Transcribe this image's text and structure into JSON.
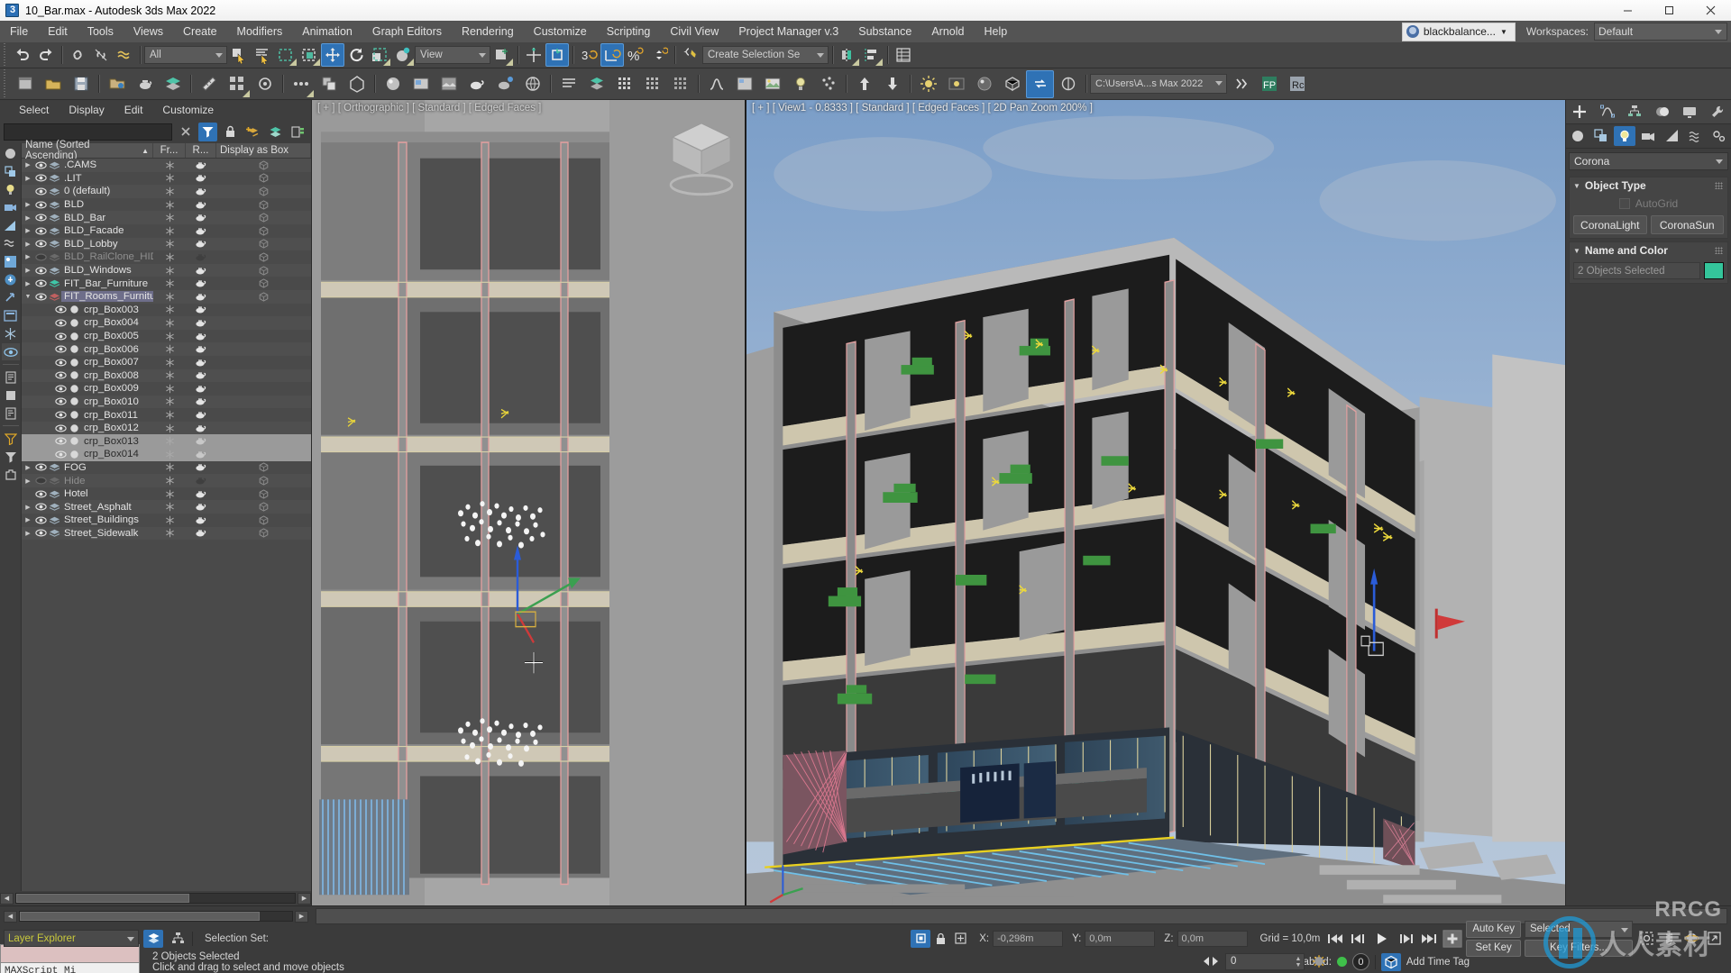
{
  "titlebar": {
    "title": "10_Bar.max - Autodesk 3ds Max 2022",
    "minimize": "minimize-icon",
    "maximize": "maximize-icon",
    "close": "close-icon"
  },
  "menubar": {
    "items": [
      "File",
      "Edit",
      "Tools",
      "Views",
      "Create",
      "Modifiers",
      "Animation",
      "Graph Editors",
      "Rendering",
      "Customize",
      "Scripting",
      "Civil View",
      "Project Manager v.3",
      "Substance",
      "Arnold",
      "Help"
    ],
    "account": "blackbalance...",
    "workspaces_label": "Workspaces:",
    "workspace_value": "Default"
  },
  "toolbar": {
    "selection_filter": "All",
    "reference_coord": "View",
    "named_selection_set": "Create Selection Se",
    "project_path": "C:\\Users\\A...s Max 2022",
    "angle_snap_value": "3",
    "percent_snap": "%"
  },
  "explorer": {
    "menu": [
      "Select",
      "Display",
      "Edit",
      "Customize"
    ],
    "search_value": "",
    "buttons": [
      "clear-icon",
      "filter-icon",
      "lock-icon",
      "add-layer-icon",
      "layers-icon",
      "tree-icon"
    ],
    "columns": {
      "name": "Name (Sorted Ascending)",
      "sort_arrow": "▲",
      "frozen": "Fr...",
      "render": "R...",
      "display_as_box": "Display as Box"
    },
    "rows": [
      {
        "label": ".CAMS",
        "indent": 0,
        "arrow": true,
        "type": "layer",
        "hidden": false,
        "selected": false
      },
      {
        "label": ".LIT",
        "indent": 0,
        "arrow": true,
        "type": "layer",
        "hidden": false,
        "selected": false
      },
      {
        "label": "0 (default)",
        "indent": 0,
        "arrow": false,
        "type": "layer",
        "hidden": false,
        "selected": false
      },
      {
        "label": "BLD",
        "indent": 0,
        "arrow": true,
        "type": "layer",
        "hidden": false,
        "selected": false
      },
      {
        "label": "BLD_Bar",
        "indent": 0,
        "arrow": true,
        "type": "layer",
        "hidden": false,
        "selected": false
      },
      {
        "label": "BLD_Facade",
        "indent": 0,
        "arrow": true,
        "type": "layer",
        "hidden": false,
        "selected": false
      },
      {
        "label": "BLD_Lobby",
        "indent": 0,
        "arrow": true,
        "type": "layer",
        "hidden": false,
        "selected": false
      },
      {
        "label": "BLD_RailClone_HIDE",
        "indent": 0,
        "arrow": true,
        "type": "layer",
        "hidden": true,
        "selected": false
      },
      {
        "label": "BLD_Windows",
        "indent": 0,
        "arrow": true,
        "type": "layer",
        "hidden": false,
        "selected": false
      },
      {
        "label": "FIT_Bar_Furniture",
        "indent": 0,
        "arrow": true,
        "type": "layer-green",
        "hidden": false,
        "selected": false
      },
      {
        "label": "FIT_Rooms_Furniture",
        "indent": 0,
        "arrow": "open",
        "type": "layer-red",
        "hidden": false,
        "selected": true
      },
      {
        "label": "crp_Box003",
        "indent": 1,
        "arrow": false,
        "type": "object",
        "hidden": false,
        "selected": false
      },
      {
        "label": "crp_Box004",
        "indent": 1,
        "arrow": false,
        "type": "object",
        "hidden": false,
        "selected": false
      },
      {
        "label": "crp_Box005",
        "indent": 1,
        "arrow": false,
        "type": "object",
        "hidden": false,
        "selected": false
      },
      {
        "label": "crp_Box006",
        "indent": 1,
        "arrow": false,
        "type": "object",
        "hidden": false,
        "selected": false
      },
      {
        "label": "crp_Box007",
        "indent": 1,
        "arrow": false,
        "type": "object",
        "hidden": false,
        "selected": false
      },
      {
        "label": "crp_Box008",
        "indent": 1,
        "arrow": false,
        "type": "object",
        "hidden": false,
        "selected": false
      },
      {
        "label": "crp_Box009",
        "indent": 1,
        "arrow": false,
        "type": "object",
        "hidden": false,
        "selected": false
      },
      {
        "label": "crp_Box010",
        "indent": 1,
        "arrow": false,
        "type": "object",
        "hidden": false,
        "selected": false
      },
      {
        "label": "crp_Box011",
        "indent": 1,
        "arrow": false,
        "type": "object",
        "hidden": false,
        "selected": false
      },
      {
        "label": "crp_Box012",
        "indent": 1,
        "arrow": false,
        "type": "object",
        "hidden": false,
        "selected": false
      },
      {
        "label": "crp_Box013",
        "indent": 1,
        "arrow": false,
        "type": "object",
        "hidden": false,
        "selected": false,
        "highlight": true
      },
      {
        "label": "crp_Box014",
        "indent": 1,
        "arrow": false,
        "type": "object",
        "hidden": false,
        "selected": false,
        "highlight": true
      },
      {
        "label": "FOG",
        "indent": 0,
        "arrow": true,
        "type": "layer",
        "hidden": false,
        "selected": false
      },
      {
        "label": "Hide",
        "indent": 0,
        "arrow": true,
        "type": "layer",
        "hidden": true,
        "selected": false
      },
      {
        "label": "Hotel",
        "indent": 0,
        "arrow": false,
        "type": "layer",
        "hidden": false,
        "selected": false
      },
      {
        "label": "Street_Asphalt",
        "indent": 0,
        "arrow": true,
        "type": "layer",
        "hidden": false,
        "selected": false
      },
      {
        "label": "Street_Buildings",
        "indent": 0,
        "arrow": true,
        "type": "layer",
        "hidden": false,
        "selected": false
      },
      {
        "label": "Street_Sidewalk",
        "indent": 0,
        "arrow": true,
        "type": "layer",
        "hidden": false,
        "selected": false
      }
    ]
  },
  "viewports": {
    "left_label": "[ + ] [ Orthographic ] [ Standard ] [ Edged Faces ]",
    "right_label": "[ + ] [ View1 - 0.8333 ] [ Standard ] [ Edged Faces ] [ 2D Pan Zoom 200% ]"
  },
  "command_panel": {
    "tabs_top": [
      "create-tab-icon",
      "modify-tab-icon",
      "hierarchy-tab-icon",
      "motion-tab-icon",
      "display-tab-icon",
      "utilities-tab-icon"
    ],
    "tabs_sub": [
      "geometry-icon",
      "shapes-icon",
      "lights-icon",
      "cameras-icon",
      "helpers-icon",
      "space-warps-icon",
      "systems-icon"
    ],
    "category": "Corona",
    "object_type_header": "Object Type",
    "autogrid_label": "AutoGrid",
    "object_buttons": [
      "CoronaLight",
      "CoronaSun"
    ],
    "name_color_header": "Name and Color",
    "name_value": "2 Objects Selected",
    "color_swatch": "#34c59b"
  },
  "statusbar": {
    "layer_explorer": "Layer Explorer",
    "selection_set_label": "Selection Set:",
    "maxscript_label": "MAXScript Mi",
    "objects_selected": "2 Objects Selected",
    "prompt": "Click and drag to select and move objects",
    "coord_x_label": "X:",
    "coord_x": "-0,298m",
    "coord_y_label": "Y:",
    "coord_y": "0,0m",
    "coord_z_label": "Z:",
    "coord_z": "0,0m",
    "grid": "Grid = 10,0m",
    "enabled_label": "Enabled:",
    "enabled_count": "0",
    "add_time_tag": "Add Time Tag",
    "auto_key": "Auto Key",
    "set_key": "Set Key",
    "key_mode": "Selected",
    "key_filters": "Key Filters...",
    "frame_value": "0"
  },
  "watermark": {
    "brand": "RRCG",
    "text": "人人素材"
  },
  "colors": {
    "accent_blue": "#2f72b5",
    "panel_bg": "#3d3d3d",
    "toolbar_bg": "#454545",
    "swatch_green": "#34c59b",
    "sky": "#8fb0d4"
  }
}
